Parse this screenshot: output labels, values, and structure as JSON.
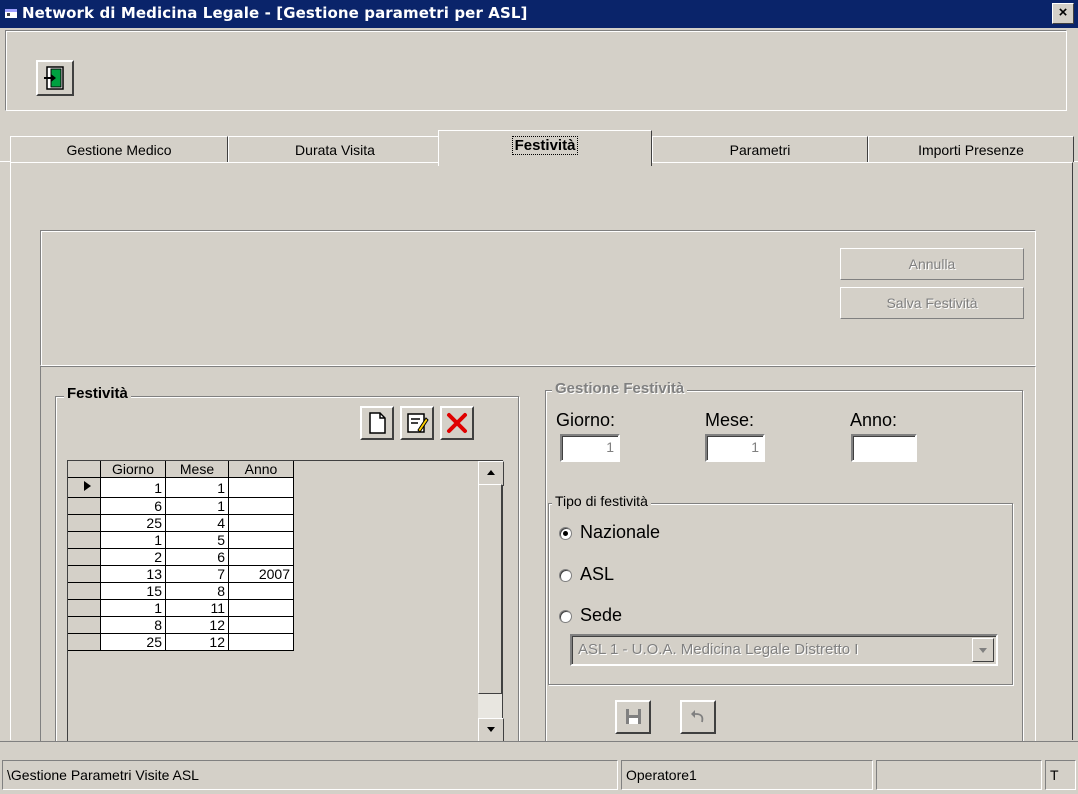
{
  "window": {
    "title": "Network di Medicina Legale - [Gestione parametri per ASL]",
    "close_label": "×"
  },
  "tabs": [
    {
      "label": "Gestione Medico"
    },
    {
      "label": "Durata Visita"
    },
    {
      "label": "Festività"
    },
    {
      "label": "Parametri"
    },
    {
      "label": "Importi Presenze"
    }
  ],
  "buttons": {
    "annulla": "Annulla",
    "salva": "Salva Festività"
  },
  "festivita_group": {
    "title": "Festività"
  },
  "grid": {
    "columns": [
      "Giorno",
      "Mese",
      "Anno"
    ],
    "rows": [
      {
        "giorno": "1",
        "mese": "1",
        "anno": ""
      },
      {
        "giorno": "6",
        "mese": "1",
        "anno": ""
      },
      {
        "giorno": "25",
        "mese": "4",
        "anno": ""
      },
      {
        "giorno": "1",
        "mese": "5",
        "anno": ""
      },
      {
        "giorno": "2",
        "mese": "6",
        "anno": ""
      },
      {
        "giorno": "13",
        "mese": "7",
        "anno": "2007"
      },
      {
        "giorno": "15",
        "mese": "8",
        "anno": ""
      },
      {
        "giorno": "1",
        "mese": "11",
        "anno": ""
      },
      {
        "giorno": "8",
        "mese": "12",
        "anno": ""
      },
      {
        "giorno": "25",
        "mese": "12",
        "anno": ""
      }
    ]
  },
  "gestione": {
    "title": "Gestione Festività",
    "giorno_label": "Giorno:",
    "giorno_value": "1",
    "mese_label": "Mese:",
    "mese_value": "1",
    "anno_label": "Anno:",
    "anno_value": "",
    "tipo_title": "Tipo di festività",
    "radio_nazionale": "Nazionale",
    "radio_asl": "ASL",
    "radio_sede": "Sede",
    "selected": "Nazionale",
    "sede_select": "ASL 1 - U.O.A. Medicina Legale Distretto I"
  },
  "statusbar": {
    "path": "\\Gestione Parametri Visite ASL",
    "operator": "Operatore1",
    "empty": "",
    "mode": "T"
  }
}
